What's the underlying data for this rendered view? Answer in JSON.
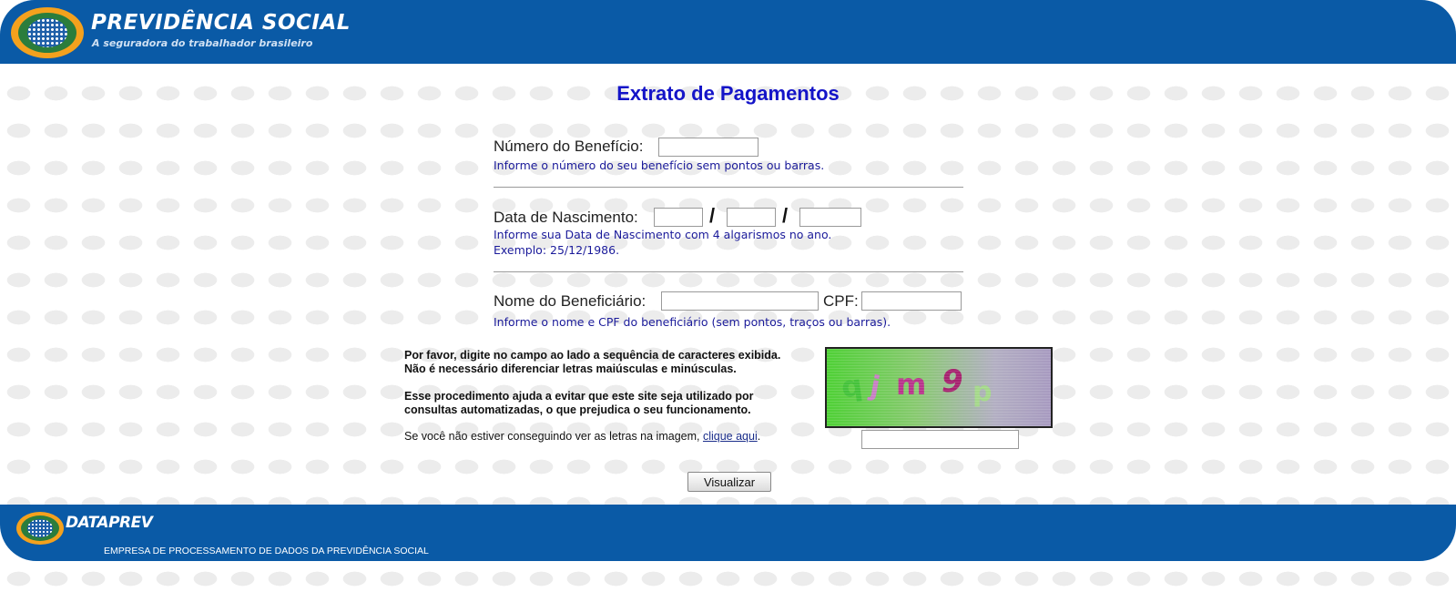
{
  "header": {
    "title": "PREVIDÊNCIA SOCIAL",
    "subtitle": "A seguradora do trabalhador brasileiro"
  },
  "page": {
    "title": "Extrato de Pagamentos"
  },
  "form": {
    "beneficio": {
      "label": "Número do Benefício:",
      "value": "",
      "hint": "Informe o número do seu benefício sem pontos ou barras."
    },
    "nascimento": {
      "label": "Data de Nascimento:",
      "separator": "/",
      "day": "",
      "month": "",
      "year": "",
      "hint_line1": "Informe sua Data de Nascimento com 4 algarismos no ano.",
      "hint_line2": "Exemplo: 25/12/1986."
    },
    "beneficiario": {
      "label": "Nome do Beneficiário:",
      "name_value": "",
      "cpf_label": "CPF:",
      "cpf_value": "",
      "hint": "Informe o nome e CPF do beneficiário (sem pontos, traços ou barras)."
    }
  },
  "captcha": {
    "instruction_line1": "Por favor, digite no campo ao lado a sequência de caracteres exibida.",
    "instruction_line2": "Não é necessário diferenciar letras maiúsculas e minúsculas.",
    "purpose_line1": "Esse procedimento ajuda a evitar que este site seja utilizado por",
    "purpose_line2": "consultas automatizadas, o que prejudica o seu funcionamento.",
    "help_text": "Se você não estiver conseguindo ver as letras na imagem, ",
    "help_link": "clique aqui",
    "help_suffix": ".",
    "characters": [
      "q",
      "j",
      "m",
      "9",
      "p"
    ],
    "char_colors": [
      "#44c23a",
      "#c77ec4",
      "#b9348c",
      "#a6226f",
      "#a4d88a"
    ],
    "input_value": ""
  },
  "submit_label": "Visualizar",
  "footer": {
    "brand": "DATAPREV",
    "subtitle": "EMPRESA DE PROCESSAMENTO DE DADOS DA PREVIDÊNCIA SOCIAL"
  },
  "colors": {
    "brand_blue": "#0a5aa6",
    "title_blue": "#1414c8",
    "hint_blue": "#1a1a9a"
  }
}
